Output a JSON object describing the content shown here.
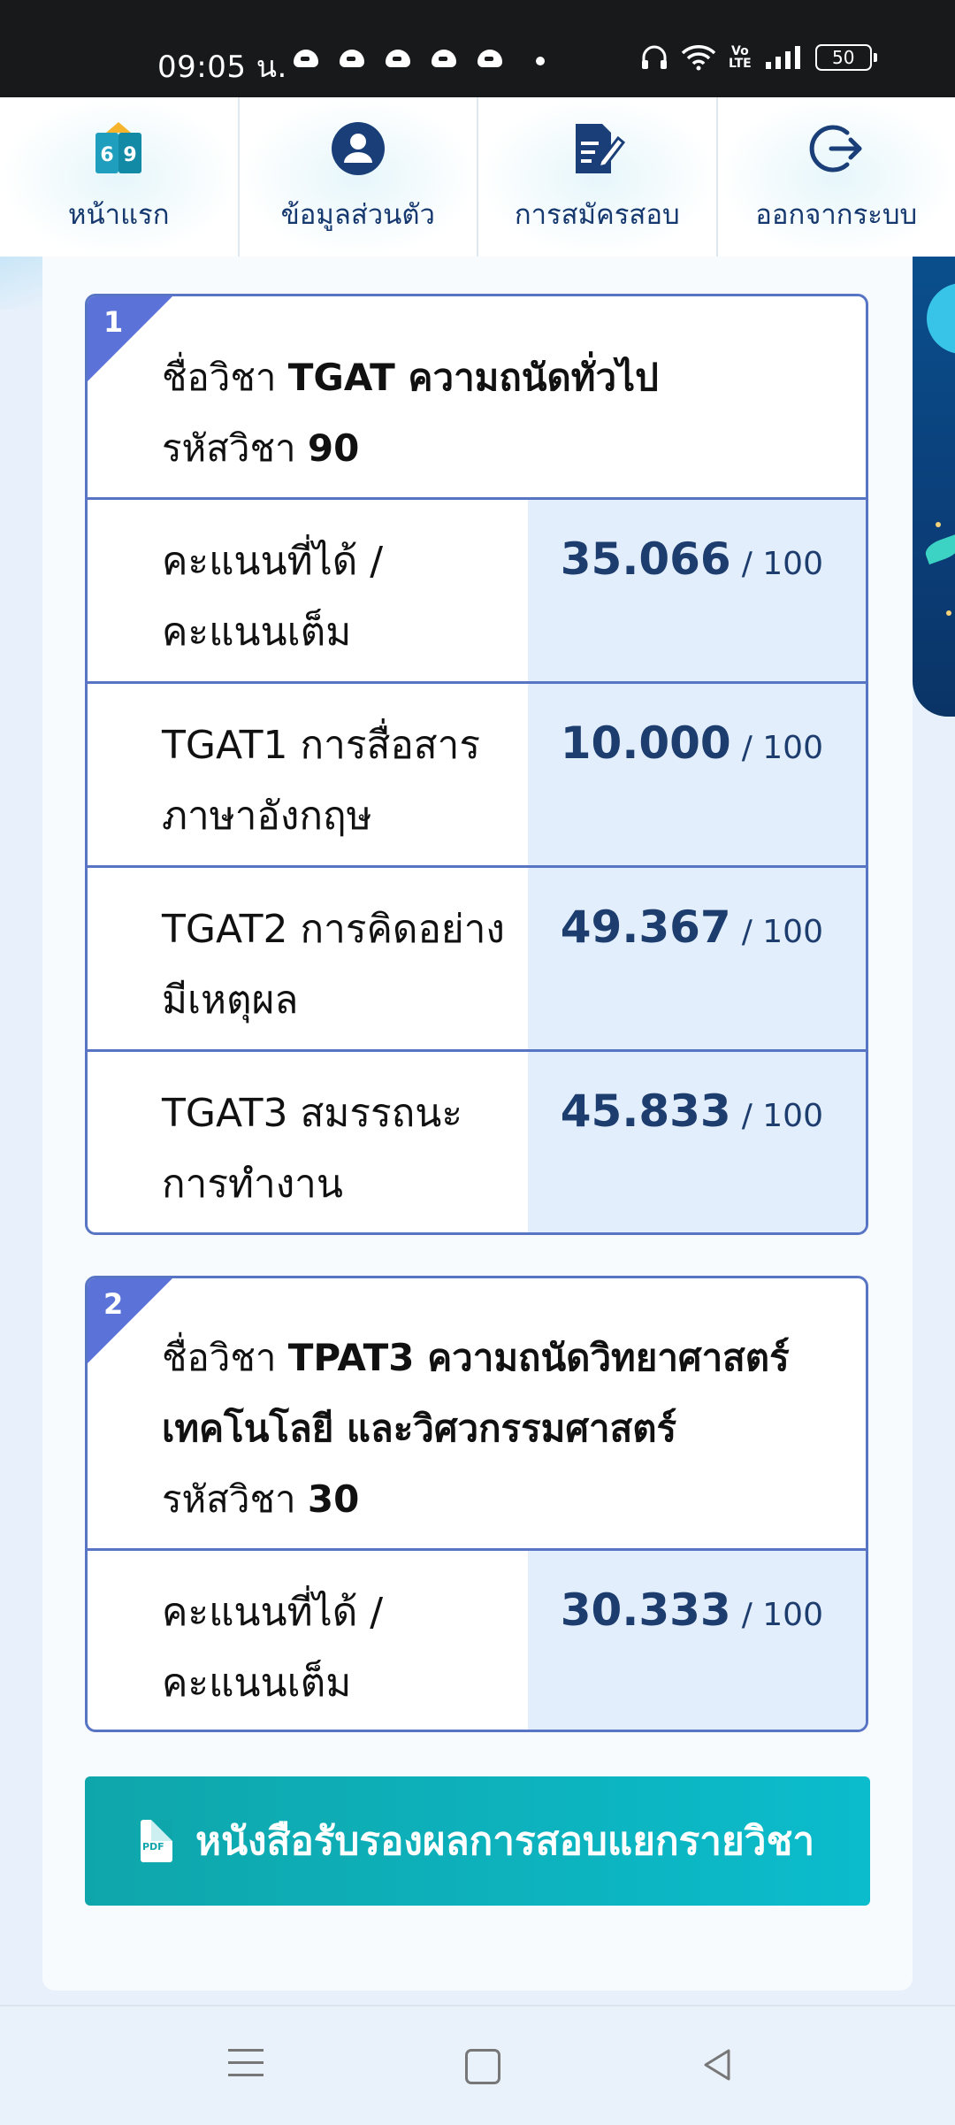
{
  "status_bar": {
    "time": "09:05 น.",
    "battery": "50",
    "network": "Vo LTE"
  },
  "top_nav": {
    "items": [
      {
        "label": "หน้าแรก",
        "icon": "book-69-icon"
      },
      {
        "label": "ข้อมูลส่วนตัว",
        "icon": "user-circle-icon"
      },
      {
        "label": "การสมัครสอบ",
        "icon": "edit-document-icon"
      },
      {
        "label": "ออกจากระบบ",
        "icon": "logout-icon"
      }
    ]
  },
  "subjects": [
    {
      "number": "1",
      "title_prefix": "ชื่อวิชา",
      "title": "TGAT ความถนัดทั่วไป",
      "code_prefix": "รหัสวิชา",
      "code": "90",
      "rows": [
        {
          "label_line1": "คะแนนที่ได้ /",
          "label_line2": "คะแนนเต็ม",
          "score": "35.066",
          "max": "/ 100"
        },
        {
          "label_line1": "TGAT1 การสื่อสาร",
          "label_line2": "ภาษาอังกฤษ",
          "score": "10.000",
          "max": "/ 100"
        },
        {
          "label_line1": "TGAT2 การคิดอย่าง",
          "label_line2": "มีเหตุผล",
          "score": "49.367",
          "max": "/ 100"
        },
        {
          "label_line1": "TGAT3 สมรรถนะ",
          "label_line2": "การทำงาน",
          "score": "45.833",
          "max": "/ 100"
        }
      ]
    },
    {
      "number": "2",
      "title_prefix": "ชื่อวิชา",
      "title": "TPAT3 ความถนัดวิทยาศาสตร์",
      "title_line2": "เทคโนโลยี และวิศวกรรมศาสตร์",
      "code_prefix": "รหัสวิชา",
      "code": "30",
      "rows": [
        {
          "label_line1": "คะแนนที่ได้ /",
          "label_line2": "คะแนนเต็ม",
          "score": "30.333",
          "max": "/ 100"
        }
      ]
    }
  ],
  "certificate_button": {
    "label": "หนังสือรับรองผลการสอบแยกรายวิชา",
    "icon": "pdf-icon",
    "icon_text": "PDF"
  },
  "colors": {
    "accent": "#5b73d8",
    "score_bg": "#e3eefc",
    "button": "#0bbccc",
    "nav_text": "#15386f"
  }
}
